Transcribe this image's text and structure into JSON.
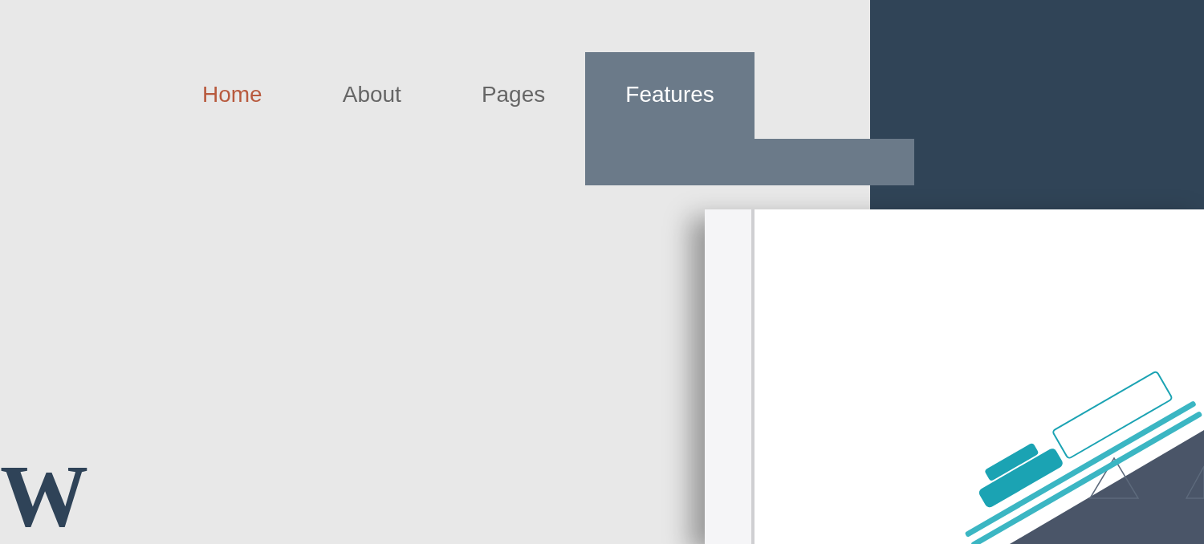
{
  "nav": {
    "items": [
      {
        "label": "Home",
        "selected": true,
        "expanded": false
      },
      {
        "label": "About",
        "selected": false,
        "expanded": false
      },
      {
        "label": "Pages",
        "selected": false,
        "expanded": false
      },
      {
        "label": "Features",
        "selected": false,
        "expanded": true
      }
    ]
  },
  "hero": {
    "heading": "W"
  }
}
